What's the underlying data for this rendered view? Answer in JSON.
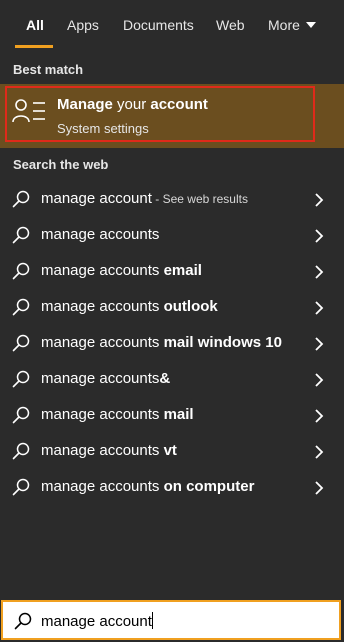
{
  "tabs": [
    {
      "label": "All",
      "active": true
    },
    {
      "label": "Apps",
      "active": false
    },
    {
      "label": "Documents",
      "active": false
    },
    {
      "label": "Web",
      "active": false
    },
    {
      "label": "More",
      "active": false
    }
  ],
  "best_match": {
    "section_label": "Best match",
    "title_parts": [
      "Manage",
      " your ",
      "account"
    ],
    "subtitle": "System settings",
    "icon": "account-settings-icon"
  },
  "web": {
    "section_label": "Search the web",
    "items": [
      {
        "prefix": "manage account",
        "suffix": "",
        "hint": " - See web results"
      },
      {
        "prefix": "manage accounts",
        "suffix": "",
        "hint": ""
      },
      {
        "prefix": "manage accounts ",
        "suffix": "email",
        "hint": ""
      },
      {
        "prefix": "manage accounts ",
        "suffix": "outlook",
        "hint": ""
      },
      {
        "prefix": "manage accounts ",
        "suffix": "mail windows 10",
        "hint": ""
      },
      {
        "prefix": "manage accounts",
        "suffix": "&",
        "hint": ""
      },
      {
        "prefix": "manage accounts ",
        "suffix": "mail",
        "hint": ""
      },
      {
        "prefix": "manage accounts ",
        "suffix": "vt",
        "hint": ""
      },
      {
        "prefix": "manage accounts ",
        "suffix": "on computer",
        "hint": ""
      }
    ]
  },
  "search": {
    "value": "manage account",
    "icon": "search-icon"
  },
  "colors": {
    "background": "#2b2b2b",
    "accent": "#f0a020",
    "best_match_bg": "#6b4e1f",
    "highlight_outline": "#e02a1a"
  }
}
